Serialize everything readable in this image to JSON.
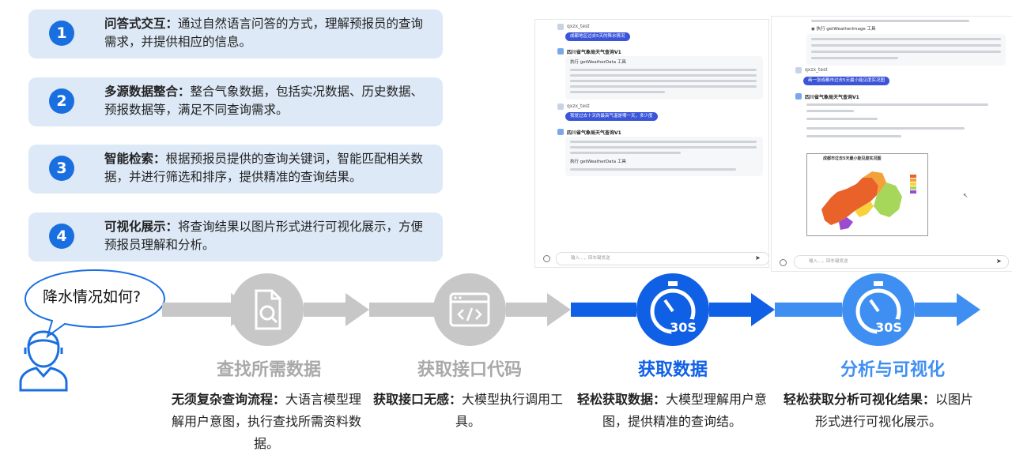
{
  "features": [
    {
      "num": "1",
      "title": "问答式交互：",
      "desc": "通过自然语言问答的方式，理解预报员的查询需求，并提供相应的信息。"
    },
    {
      "num": "2",
      "title": "多源数据整合：",
      "desc": "整合气象数据，包括实况数据、历史数据、预报数据等，满足不同查询需求。"
    },
    {
      "num": "3",
      "title": "智能检索：",
      "desc": "根据预报员提供的查询关键词，智能匹配相关数据，并进行筛选和排序，提供精准的查询结果。"
    },
    {
      "num": "4",
      "title": "可视化展示：",
      "desc": "将查询结果以图片形式进行可视化展示，方便预报员理解和分析。"
    }
  ],
  "chat_left": {
    "user": "qxzx_test",
    "q1": "成都地区过去5天的降水情况",
    "bot": "四川省气象局天气查询V1",
    "tool": "执行 getWeatherData 工具",
    "q2": "我觉过去十天的最高气温是哪一天，多少度",
    "tool2": "执行 getWeatherData 工具",
    "input_placeholder": "输入…，回车键发送"
  },
  "chat_right": {
    "user": "qxzx_test",
    "q1": "画一张成都市过去5天最小能见度实况图",
    "bot": "四川省气象局天气查询V1",
    "tool": "执行 getWeatherImage 工具",
    "map_title": "成都市过去5天最小能见度实况图",
    "input_placeholder": "输入…，回车键发送"
  },
  "question_bubble": "降水情况如何?",
  "steps": [
    {
      "name": "查找所需数据",
      "color": "#a9a9a9",
      "desc_title": "无须复杂查询流程：",
      "desc": "大语言模型理解用户意图，执行查找所需资料数据。"
    },
    {
      "name": "获取接口代码",
      "color": "#a9a9a9",
      "desc_title": "获取接口无感：",
      "desc": "大模型执行调用工具。"
    },
    {
      "name": "获取数据",
      "color": "#1060e6",
      "desc_title": "轻松获取数据：",
      "desc": "大模型理解用户意图，提供精准的查询结。"
    },
    {
      "name": "分析与可视化",
      "color": "#3f8ff2",
      "desc_title": "轻松获取分析可视化结果：",
      "desc": "以图片形式进行可视化展示。"
    }
  ],
  "timer_label": "30S",
  "colors": {
    "accent": "#1a6fe0",
    "card_bg": "#dde9f7",
    "grey_step": "#c7c7c7",
    "blue_step": "#1060e6",
    "light_blue_step": "#3f8ff2"
  }
}
